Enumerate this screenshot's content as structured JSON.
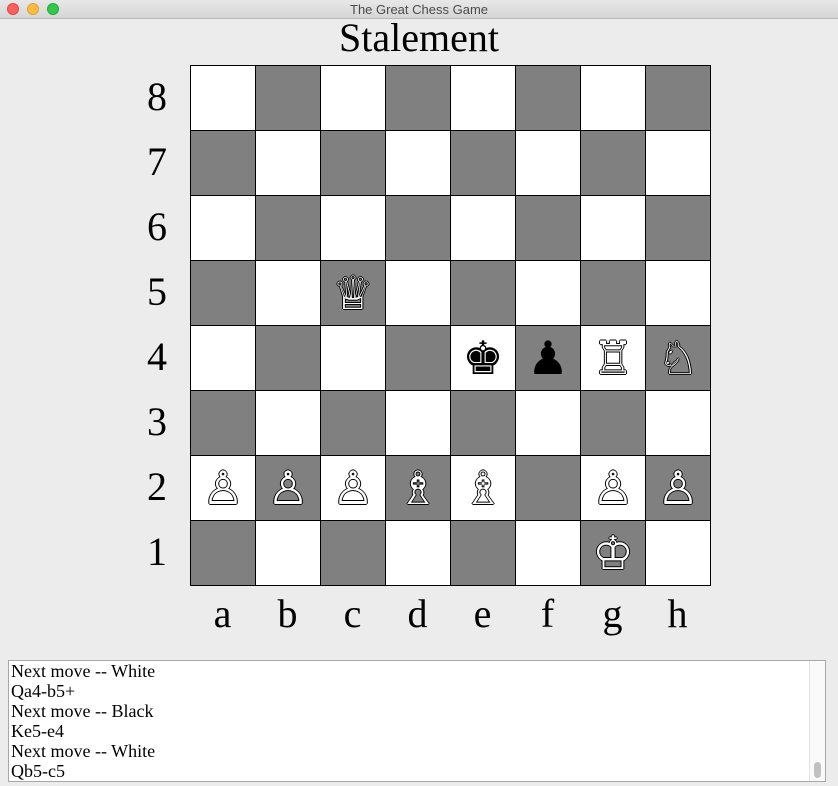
{
  "window": {
    "title": "The Great Chess Game"
  },
  "status": "Stalement",
  "ranks": [
    "8",
    "7",
    "6",
    "5",
    "4",
    "3",
    "2",
    "1"
  ],
  "files": [
    "a",
    "b",
    "c",
    "d",
    "e",
    "f",
    "g",
    "h"
  ],
  "board": [
    [
      null,
      null,
      null,
      null,
      null,
      null,
      null,
      null
    ],
    [
      null,
      null,
      null,
      null,
      null,
      null,
      null,
      null
    ],
    [
      null,
      null,
      null,
      null,
      null,
      null,
      null,
      null
    ],
    [
      null,
      null,
      {
        "color": "white",
        "type": "queen",
        "glyph": "♕"
      },
      null,
      null,
      null,
      null,
      null
    ],
    [
      null,
      null,
      null,
      null,
      {
        "color": "black",
        "type": "king",
        "glyph": "♚"
      },
      {
        "color": "black",
        "type": "pawn",
        "glyph": "♟"
      },
      {
        "color": "white",
        "type": "rook",
        "glyph": "♖"
      },
      {
        "color": "white",
        "type": "knight",
        "glyph": "♘"
      }
    ],
    [
      null,
      null,
      null,
      null,
      null,
      null,
      null,
      null
    ],
    [
      {
        "color": "white",
        "type": "pawn",
        "glyph": "♙"
      },
      {
        "color": "white",
        "type": "pawn",
        "glyph": "♙"
      },
      {
        "color": "white",
        "type": "pawn",
        "glyph": "♙"
      },
      {
        "color": "white",
        "type": "bishop",
        "glyph": "♗"
      },
      {
        "color": "white",
        "type": "bishop",
        "glyph": "♗"
      },
      null,
      {
        "color": "white",
        "type": "pawn",
        "glyph": "♙"
      },
      {
        "color": "white",
        "type": "pawn",
        "glyph": "♙"
      }
    ],
    [
      null,
      null,
      null,
      null,
      null,
      null,
      {
        "color": "white",
        "type": "king",
        "glyph": "♔"
      },
      null
    ]
  ],
  "colors": {
    "light_square": "#ffffff",
    "dark_square": "#808080"
  },
  "log": {
    "lines": [
      "Next move -- White",
      "Qa4-b5+",
      "Next move -- Black",
      "Ke5-e4",
      "Next move -- White",
      "Qb5-c5"
    ]
  }
}
